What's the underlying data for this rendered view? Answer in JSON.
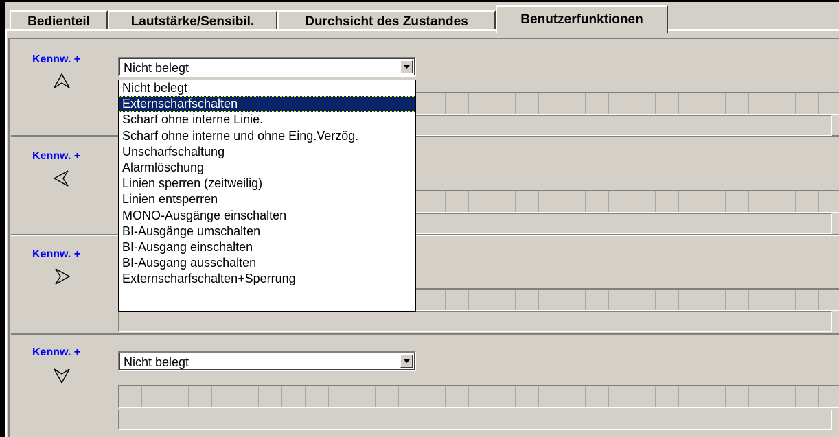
{
  "tabs": [
    {
      "label": "Bedienteil",
      "active": false
    },
    {
      "label": "Lautstärke/Sensibil.",
      "active": false
    },
    {
      "label": "Durchsicht des Zustandes",
      "active": false
    },
    {
      "label": "Benutzerfunktionen",
      "active": true
    }
  ],
  "groups": [
    {
      "kennw_label": "Kennw. +",
      "arrow_icon": "arrow-up-icon",
      "combo_value": "Nicht belegt"
    },
    {
      "kennw_label": "Kennw. +",
      "arrow_icon": "arrow-left-icon",
      "combo_value": ""
    },
    {
      "kennw_label": "Kennw. +",
      "arrow_icon": "arrow-right-icon",
      "combo_value": ""
    },
    {
      "kennw_label": "Kennw. +",
      "arrow_icon": "arrow-down-icon",
      "combo_value": "Nicht belegt"
    }
  ],
  "dropdown": {
    "selected_index": 1,
    "options": [
      "Nicht belegt",
      "Externscharfschalten",
      "Scharf ohne interne Linie.",
      "Scharf ohne interne und ohne Eing.Verzög.",
      "Unscharfschaltung",
      "Alarmlöschung",
      "Linien sperren (zeitweilig)",
      "Linien entsperren",
      "MONO-Ausgänge einschalten",
      "BI-Ausgänge umschalten",
      "BI-Ausgang einschalten",
      "BI-Ausgang ausschalten",
      "Externscharfschalten+Sperrung"
    ]
  },
  "colors": {
    "panel_bg": "#d4d0c8",
    "kennw_blue": "#0000ff",
    "selection_bg": "#0a246a"
  }
}
